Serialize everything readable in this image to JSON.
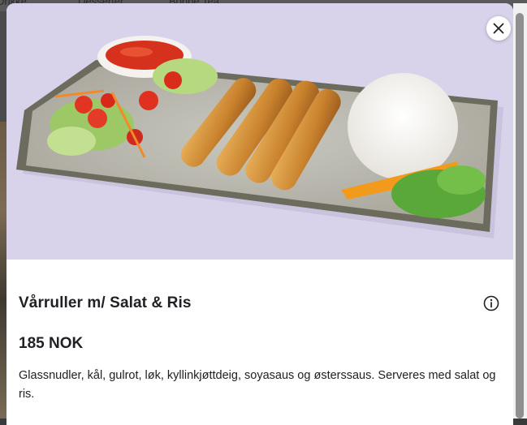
{
  "background": {
    "tabs": [
      "Drikke",
      "Desserter",
      "Bobbe Tea"
    ]
  },
  "item": {
    "name": "Vårruller m/ Salat & Ris",
    "price": "185 NOK",
    "description": "Glassnudler, kål, gulrot, løk, kyllinkjøttdeig, soyasaus og østerssaus. Serveres med salat og ris."
  },
  "icons": {
    "close": "close-icon",
    "info": "info-icon"
  },
  "colors": {
    "hero_background": "#d9d3ec",
    "text": "#202125"
  }
}
